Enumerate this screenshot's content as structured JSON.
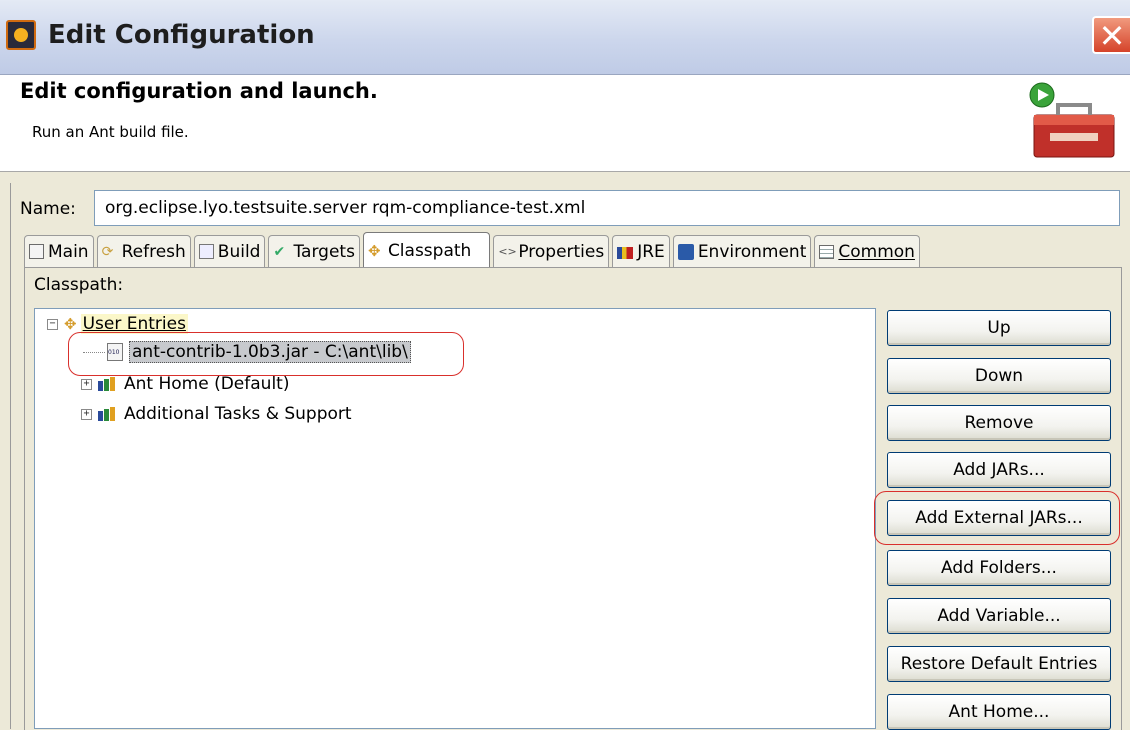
{
  "window": {
    "title": "Edit Configuration"
  },
  "header": {
    "title": "Edit configuration and launch.",
    "subtitle": "Run an Ant build file."
  },
  "name_field": {
    "label": "Name:",
    "value": "org.eclipse.lyo.testsuite.server rqm-compliance-test.xml"
  },
  "tabs": [
    {
      "label": "Main",
      "icon": "main-tab-icon"
    },
    {
      "label": "Refresh",
      "icon": "refresh-icon"
    },
    {
      "label": "Build",
      "icon": "build-icon"
    },
    {
      "label": "Targets",
      "icon": "targets-icon"
    },
    {
      "label": "Classpath",
      "icon": "classpath-icon",
      "active": true
    },
    {
      "label": "Properties",
      "icon": "properties-icon"
    },
    {
      "label": "JRE",
      "icon": "jre-icon"
    },
    {
      "label": "Environment",
      "icon": "environment-icon"
    },
    {
      "label": "Common",
      "icon": "common-icon"
    }
  ],
  "classpath": {
    "label": "Classpath:",
    "tree": {
      "user_entries": "User Entries",
      "jar_entry": "ant-contrib-1.0b3.jar - C:\\ant\\lib\\",
      "ant_home": "Ant Home (Default)",
      "additional": "Additional Tasks & Support"
    }
  },
  "buttons": {
    "up": "Up",
    "down": "Down",
    "remove": "Remove",
    "add_jars": "Add JARs...",
    "add_external_jars": "Add External JARs...",
    "add_folders": "Add Folders...",
    "add_variable": "Add Variable...",
    "restore_defaults": "Restore Default Entries",
    "ant_home": "Ant Home..."
  },
  "colors": {
    "annotation": "#d9302c",
    "title_bar": "#ccd6ec",
    "selection": "#c7c9cd"
  }
}
